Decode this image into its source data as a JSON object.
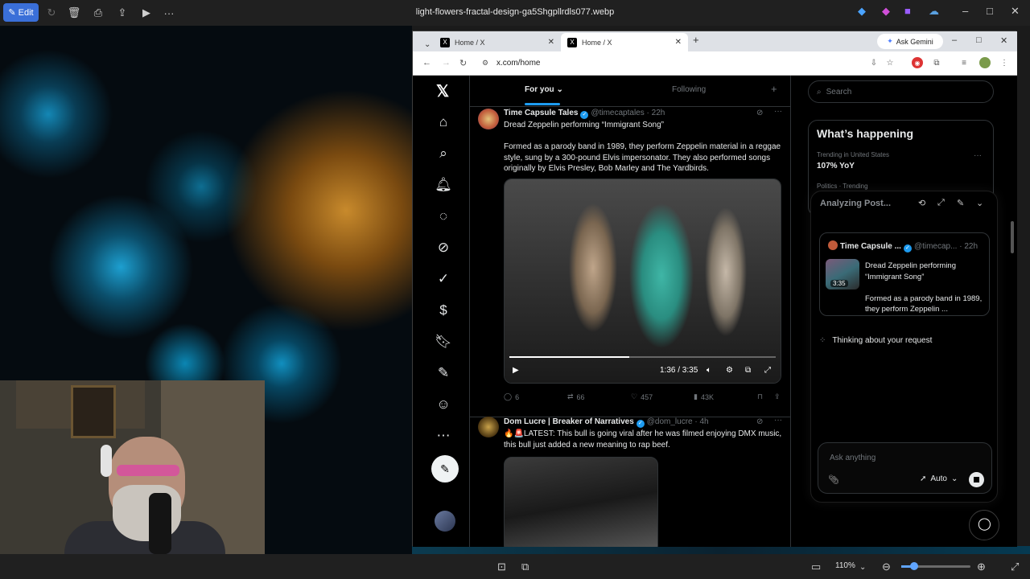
{
  "viewer": {
    "edit_label": "Edit",
    "file_name": "light-flowers-fractal-design-ga5Shgpllrdls077.webp",
    "zoom": "110%"
  },
  "browser": {
    "tabs": [
      {
        "label": "Home / X"
      },
      {
        "label": "Home / X"
      }
    ],
    "gemini_label": "Ask Gemini",
    "url": "x.com/home"
  },
  "feed": {
    "tab_for_you": "For you",
    "tab_following": "Following"
  },
  "posts": [
    {
      "name": "Time Capsule Tales",
      "handle": "@timecaptales",
      "time": "· 22h",
      "text": "Dread Zeppelin performing “Immigrant Song”\n\nFormed as a parody band in 1989, they perform Zeppelin material in a reggae style, sung by a 300-pound Elvis impersonator. They also performed songs originally by Elvis Presley, Bob Marley and The Yardbirds.",
      "video_time": "1:36 / 3:35",
      "progress": 0.45,
      "replies": "6",
      "reposts": "66",
      "likes": "457",
      "views": "43K"
    },
    {
      "name": "Dom Lucre | Breaker of Narratives",
      "handle": "@dom_lucre",
      "time": "· 4h",
      "text": "🔥🚨LATEST: This bull is going viral after he was filmed enjoying DMX music, this bull just added a new meaning to rap beef."
    }
  ],
  "sidebar": {
    "search_placeholder": "Search",
    "happening_title": "What’s happening",
    "trend_context": "Trending in United States",
    "trend_name": "107% YoY",
    "trend_context2": "Politics · Trending"
  },
  "grok": {
    "title": "Analyzing Post...",
    "quote_name": "Time Capsule ...",
    "quote_handle": "@timecap...",
    "quote_time": "· 22h",
    "quote_duration": "3:35",
    "quote_text": "Dread Zeppelin performing “Immigrant Song”\n\nFormed as a parody band in 1989, they perform Zeppelin ...",
    "thinking": "Thinking about your request",
    "ask_placeholder": "Ask anything",
    "mode": "Auto"
  },
  "colors": {
    "x_blue": "#1d9bf0",
    "edit_blue": "#3a6fd8"
  }
}
